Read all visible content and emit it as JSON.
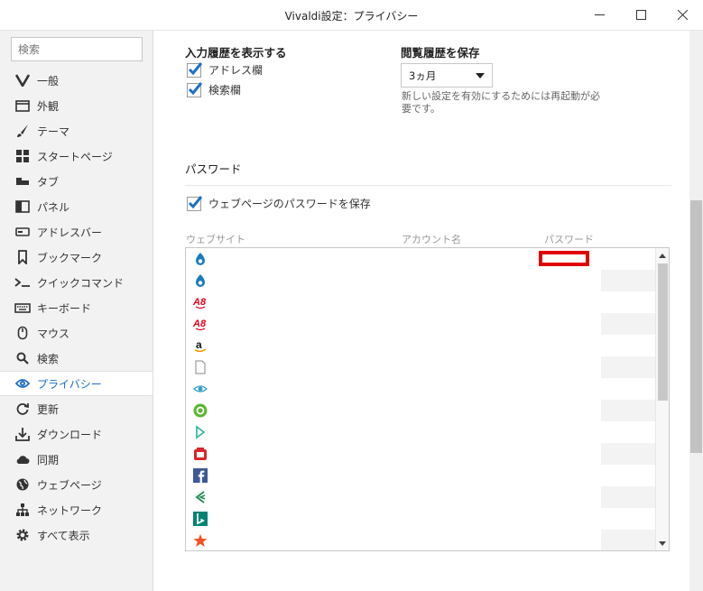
{
  "window": {
    "title": "Vivaldi設定：プライバシー",
    "minimize_glyph": "—",
    "maximize_glyph": "☐",
    "close_glyph": "✕"
  },
  "sidebar": {
    "search_placeholder": "検索",
    "items": [
      {
        "label": "一般",
        "icon": "vivaldi-logo-icon",
        "active": false
      },
      {
        "label": "外観",
        "icon": "folder-icon",
        "active": false
      },
      {
        "label": "テーマ",
        "icon": "brush-icon",
        "active": false
      },
      {
        "label": "スタートページ",
        "icon": "grid-icon",
        "active": false
      },
      {
        "label": "タブ",
        "icon": "tab-icon",
        "active": false
      },
      {
        "label": "パネル",
        "icon": "panel-icon",
        "active": false
      },
      {
        "label": "アドレスバー",
        "icon": "address-bar-icon",
        "active": false
      },
      {
        "label": "ブックマーク",
        "icon": "bookmark-icon",
        "active": false
      },
      {
        "label": "クイックコマンド",
        "icon": "quick-command-icon",
        "active": false
      },
      {
        "label": "キーボード",
        "icon": "keyboard-icon",
        "active": false
      },
      {
        "label": "マウス",
        "icon": "mouse-icon",
        "active": false
      },
      {
        "label": "検索",
        "icon": "search-icon",
        "active": false
      },
      {
        "label": "プライバシー",
        "icon": "eye-icon",
        "active": true
      },
      {
        "label": "更新",
        "icon": "refresh-icon",
        "active": false
      },
      {
        "label": "ダウンロード",
        "icon": "download-icon",
        "active": false
      },
      {
        "label": "同期",
        "icon": "cloud-icon",
        "active": false
      },
      {
        "label": "ウェブページ",
        "icon": "globe-icon",
        "active": false
      },
      {
        "label": "ネットワーク",
        "icon": "network-icon",
        "active": false
      },
      {
        "label": "すべて表示",
        "icon": "gear-icon",
        "active": false
      }
    ]
  },
  "main": {
    "history_section": "入力履歴を表示する",
    "address_field_label": "アドレス欄",
    "address_field_checked": true,
    "search_field_label": "検索欄",
    "search_field_checked": true,
    "save_history_label": "閲覧履歴を保存",
    "save_history_value": "3ヵ月",
    "restart_note": "新しい設定を有効にするためには再起動が必要です。",
    "password_section": "パスワード",
    "save_passwords_label": "ウェブページのパスワードを保存",
    "save_passwords_checked": true,
    "columns": {
      "website": "ウェブサイト",
      "account": "アカウント名",
      "password": "パスワード"
    },
    "rows": [
      {
        "favicon": "drupal-favicon-icon"
      },
      {
        "favicon": "drupal-favicon-icon"
      },
      {
        "favicon": "a8-favicon-icon"
      },
      {
        "favicon": "a8-favicon-icon"
      },
      {
        "favicon": "amazon-favicon-icon"
      },
      {
        "favicon": "blank-page-favicon-icon"
      },
      {
        "favicon": "eye-circle-favicon-icon"
      },
      {
        "favicon": "green-circle-favicon-icon"
      },
      {
        "favicon": "d-logo-favicon-icon"
      },
      {
        "favicon": "red-box-favicon-icon"
      },
      {
        "favicon": "facebook-favicon-icon"
      },
      {
        "favicon": "green-arrow-favicon-icon"
      },
      {
        "favicon": "bing-favicon-icon"
      },
      {
        "favicon": "orange-star-favicon-icon"
      }
    ]
  },
  "colors": {
    "accent": "#1e70c4",
    "highlight": "#e00000"
  }
}
